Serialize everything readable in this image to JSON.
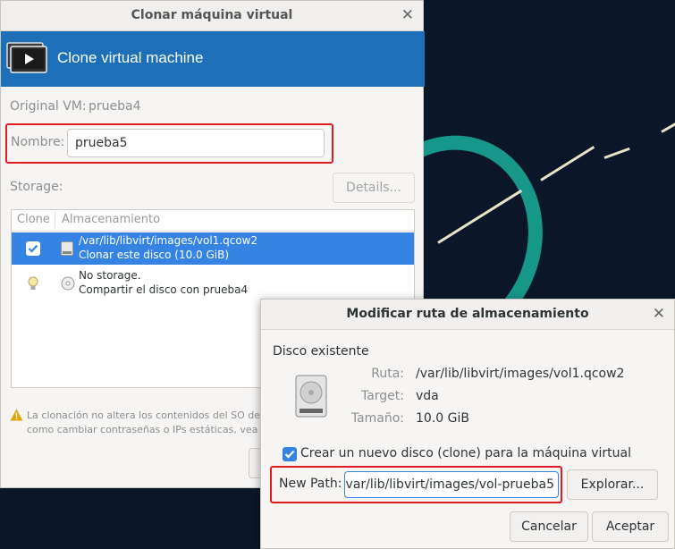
{
  "clone_dialog": {
    "title": "Clonar máquina virtual",
    "banner_title": "Clone virtual machine",
    "original_vm_label": "Original VM:",
    "original_vm_value": "prueba4",
    "name_label": "Nombre:",
    "name_value": "prueba5",
    "storage_label": "Storage:",
    "details_button": "Details...",
    "table": {
      "col_clone": "Clone",
      "col_storage": "Almacenamiento",
      "rows": [
        {
          "checked": true,
          "line1": "/var/lib/libvirt/images/vol1.qcow2",
          "line2": "Clonar este disco (10.0 GiB)",
          "icon": "disk-icon"
        },
        {
          "checked": false,
          "line1": "No storage.",
          "line2": "Compartir el disco con prueba4",
          "icon": "cdrom-icon"
        }
      ]
    },
    "warning_line1": "La clonación no altera los contenidos del SO del i",
    "warning_line2": "como cambiar contraseñas o IPs estáticas, vea la"
  },
  "modify_dialog": {
    "title": "Modificar ruta de almacenamiento",
    "existing_disk_heading": "Disco existente",
    "path_label": "Ruta:",
    "path_value": "/var/lib/libvirt/images/vol1.qcow2",
    "target_label": "Target:",
    "target_value": "vda",
    "size_label": "Tamaño:",
    "size_value": "10.0 GiB",
    "create_new_label": "Crear un nuevo disco (clone) para la máquina virtual",
    "create_new_checked": true,
    "new_path_label": "New Path:",
    "new_path_value": "'var/lib/libvirt/images/vol-prueba5",
    "browse_button": "Explorar...",
    "cancel_button": "Cancelar",
    "accept_button": "Aceptar"
  },
  "colors": {
    "banner": "#1d70b7",
    "selection": "#3584e4",
    "highlight_box": "#e01b24",
    "desktop_accent": "#17968a"
  }
}
